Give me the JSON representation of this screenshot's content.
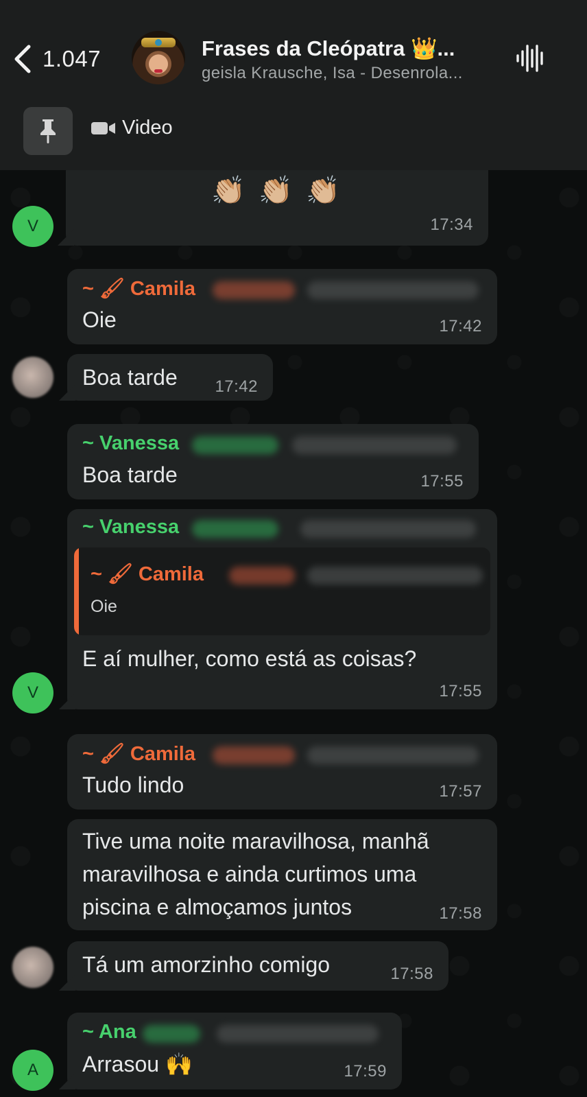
{
  "header": {
    "back_count": "1.047",
    "title": "Frases da Cleópatra 👑...",
    "subtitle": "geisla Krausche, Isa - Desenrola...",
    "video_label": "Video"
  },
  "messages": [
    {
      "text": "👏🏼 👏🏼 👏🏼",
      "time": "17:34",
      "avatar_letter": "V"
    },
    {
      "sender": "~ 🖌 Camila",
      "text": "Oie",
      "time": "17:42"
    },
    {
      "text": "Boa tarde",
      "time": "17:42"
    },
    {
      "sender": "~ Vanessa",
      "text": "Boa tarde",
      "time": "17:55"
    },
    {
      "sender": "~ Vanessa",
      "quote_sender": "~ 🖌 Camila",
      "quote_text": "Oie",
      "text": "E aí mulher, como está as coisas?",
      "time": "17:55",
      "avatar_letter": "V"
    },
    {
      "sender": "~ 🖌 Camila",
      "text": "Tudo lindo",
      "time": "17:57"
    },
    {
      "lines": [
        "Tive uma noite maravilhosa, manhã",
        "maravilhosa e ainda curtimos uma",
        "piscina e almoçamos juntos"
      ],
      "time": "17:58"
    },
    {
      "text": "Tá um amorzinho comigo",
      "time": "17:58"
    },
    {
      "sender": "~ Ana",
      "text": "Arrasou 🙌",
      "time": "17:59",
      "avatar_letter": "A"
    }
  ],
  "colors": {
    "header_bg": "#1c1e1e",
    "bubble_bg": "#202323",
    "sender_orange": "#ef6a3a",
    "sender_green": "#47d16d",
    "avatar_green": "#3ec25a"
  },
  "icons": [
    "back-chevron-icon",
    "group-avatar",
    "voice-wave-icon",
    "pin-icon",
    "video-camera-icon"
  ]
}
